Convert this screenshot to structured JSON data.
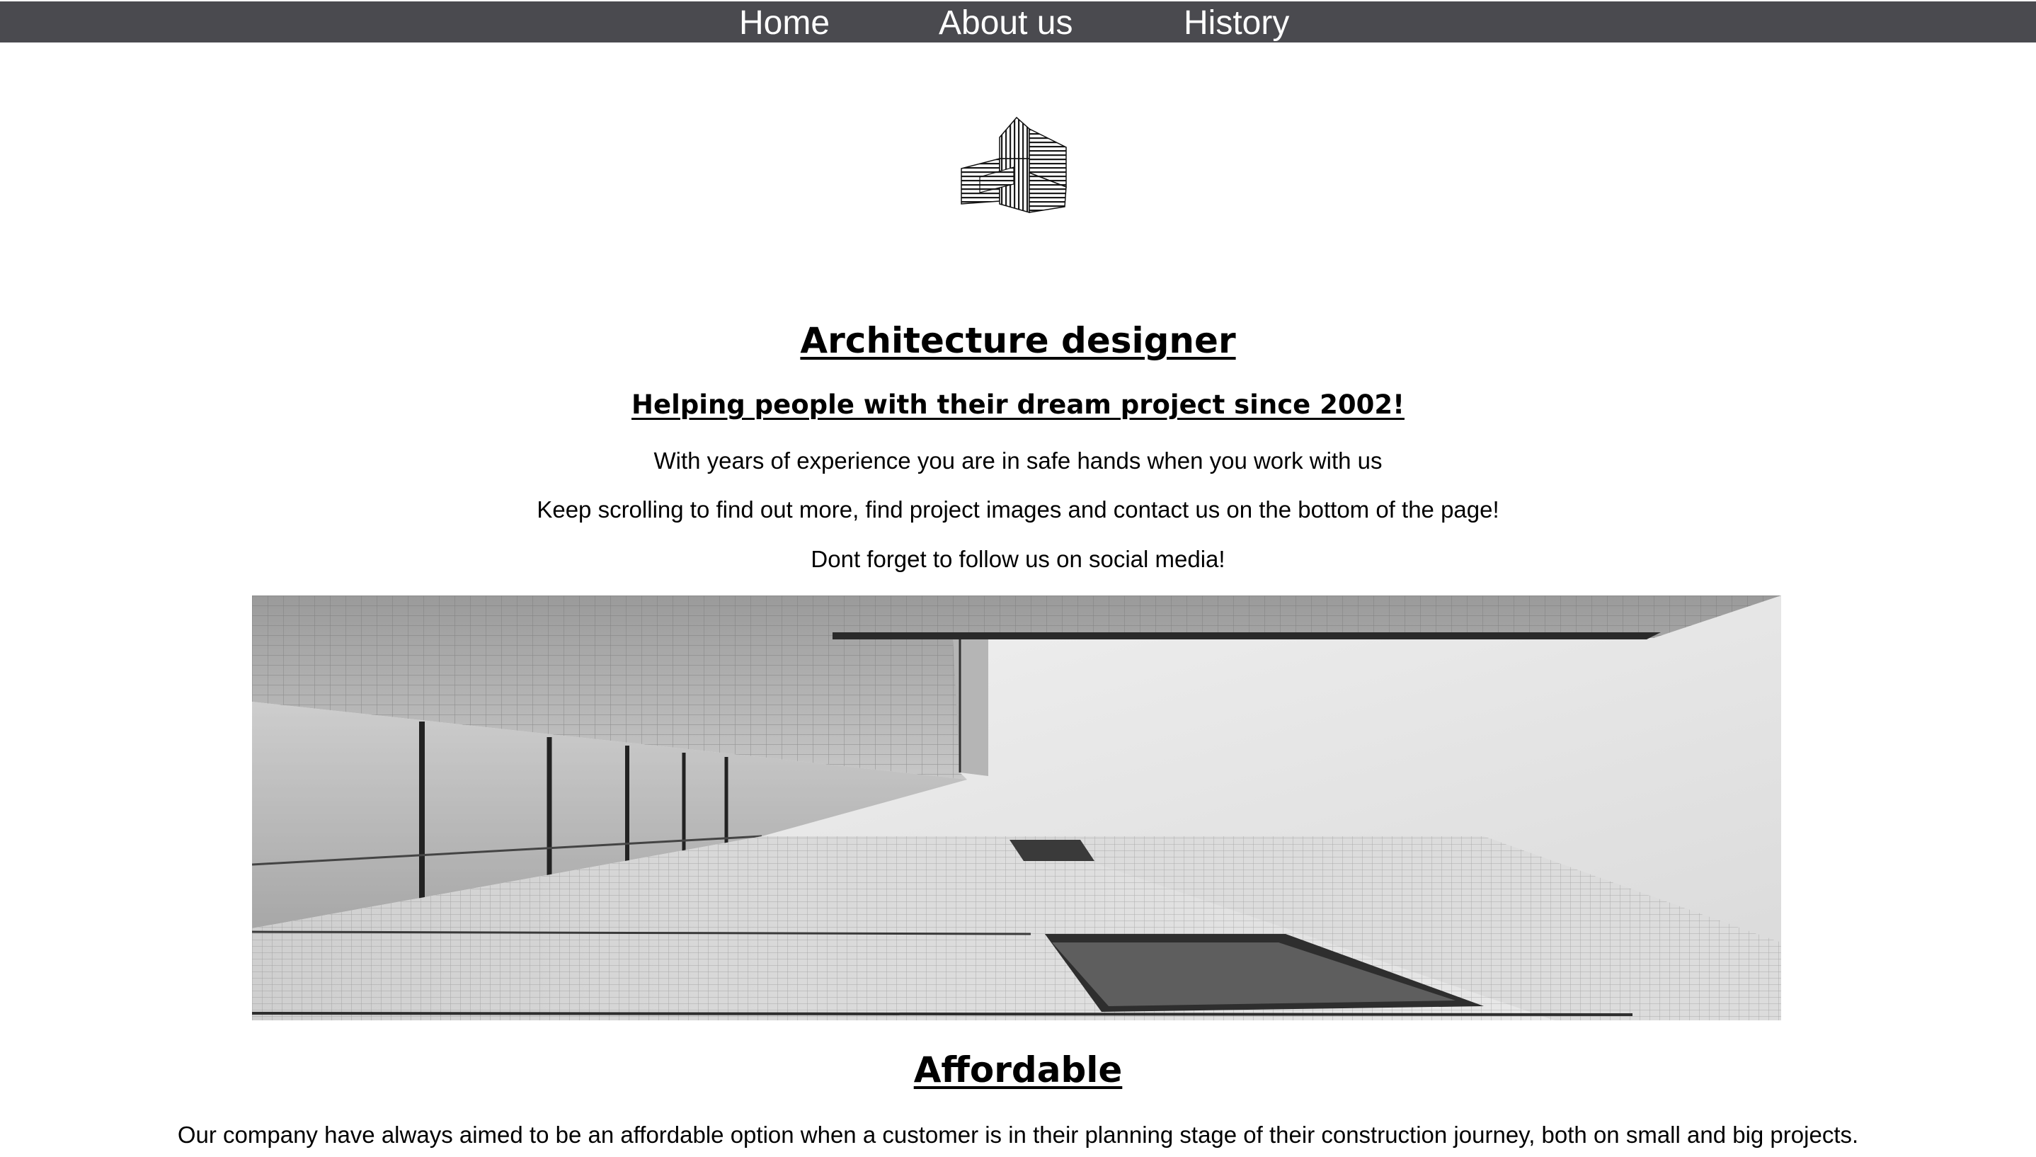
{
  "nav": {
    "items": [
      {
        "label": "Home"
      },
      {
        "label": "About us"
      },
      {
        "label": "History"
      }
    ]
  },
  "logo": {
    "icon": "building-logo-icon"
  },
  "hero_text": {
    "title": "Architecture designer",
    "subtitle": "Helping people with their dream project since 2002!",
    "line1": "With years of experience you are in safe hands when you work with us",
    "line2": "Keep scrolling to find out more, find project images and contact us on the bottom of the page!",
    "line3": "Dont forget to follow us on social media!"
  },
  "hero_image": {
    "subject": "building-photo"
  },
  "affordable": {
    "title": "Affordable",
    "body": "Our company have always aimed to be an affordable option when a customer is in their planning stage of their construction journey, both on small and big projects."
  },
  "colors": {
    "nav_bg": "#4a4a4f",
    "nav_text": "#ffffff",
    "page_bg": "#ffffff",
    "text": "#000000"
  }
}
